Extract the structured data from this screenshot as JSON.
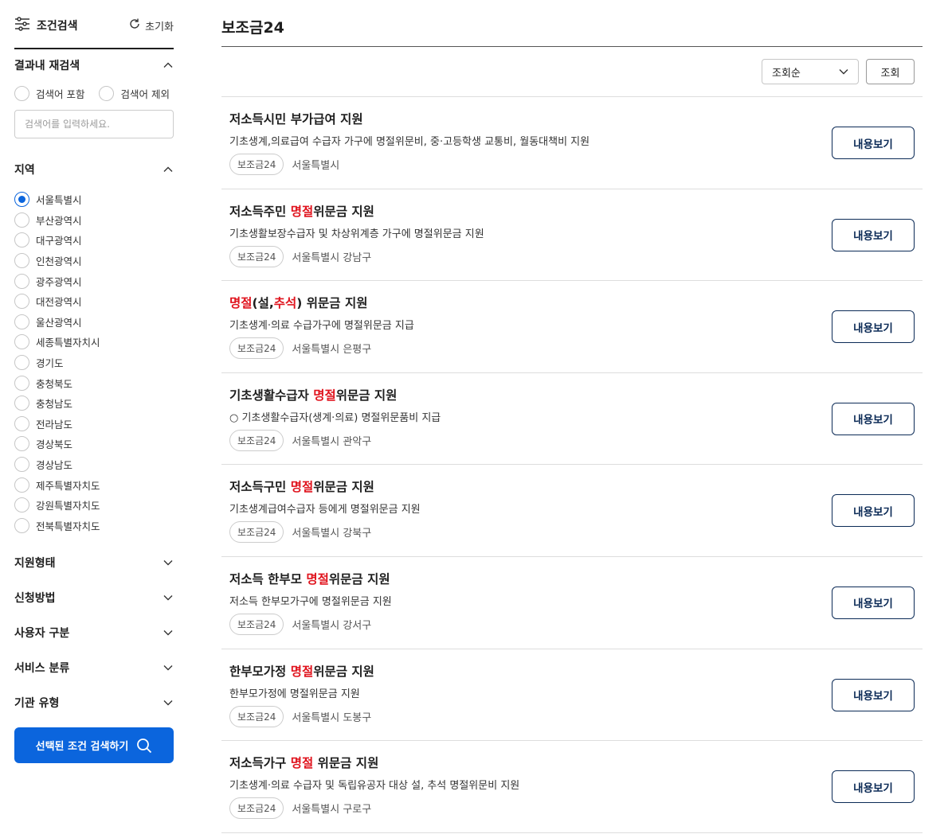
{
  "sidebar": {
    "title": "조건검색",
    "reset_label": "초기화",
    "refine": {
      "heading": "결과내 재검색",
      "include_label": "검색어 포함",
      "exclude_label": "검색어 제외",
      "input_placeholder": "검색어를 입력하세요."
    },
    "region": {
      "heading": "지역",
      "selected": "서울특별시",
      "options": [
        "서울특별시",
        "부산광역시",
        "대구광역시",
        "인천광역시",
        "광주광역시",
        "대전광역시",
        "울산광역시",
        "세종특별자치시",
        "경기도",
        "충청북도",
        "충청남도",
        "전라남도",
        "경상북도",
        "경상남도",
        "제주특별자치도",
        "강원특별자치도",
        "전북특별자치도"
      ]
    },
    "sections": [
      "지원형태",
      "신청방법",
      "사용자 구분",
      "서비스 분류",
      "기관 유형"
    ],
    "submit_label": "선택된 조건 검색하기"
  },
  "main": {
    "title": "보조금24",
    "sort_value": "조회순",
    "search_button": "조회",
    "detail_label": "내용보기",
    "items": [
      {
        "title_parts": [
          {
            "t": "저소득시민 부가급여 지원",
            "h": false
          }
        ],
        "desc": "기초생계,의료급여 수급자 가구에 명절위문비, 중·고등학생 교통비, 월동대책비 지원",
        "tag": "보조금24",
        "region": "서울특별시"
      },
      {
        "title_parts": [
          {
            "t": "저소득주민 ",
            "h": false
          },
          {
            "t": "명절",
            "h": true
          },
          {
            "t": "위문금 지원",
            "h": false
          }
        ],
        "desc": "기초생활보장수급자 및 차상위계층 가구에 명절위문금 지원",
        "tag": "보조금24",
        "region": "서울특별시 강남구"
      },
      {
        "title_parts": [
          {
            "t": "명절",
            "h": true
          },
          {
            "t": "(설,",
            "h": false
          },
          {
            "t": "추석",
            "h": true
          },
          {
            "t": ") 위문금 지원",
            "h": false
          }
        ],
        "desc": "기초생계·의료 수급가구에 명절위문금 지급",
        "tag": "보조금24",
        "region": "서울특별시 은평구"
      },
      {
        "title_parts": [
          {
            "t": "기초생활수급자 ",
            "h": false
          },
          {
            "t": "명절",
            "h": true
          },
          {
            "t": "위문금 지원",
            "h": false
          }
        ],
        "desc": "○ 기초생활수급자(생계·의료) 명절위문품비 지급",
        "tag": "보조금24",
        "region": "서울특별시 관악구"
      },
      {
        "title_parts": [
          {
            "t": "저소득구민 ",
            "h": false
          },
          {
            "t": "명절",
            "h": true
          },
          {
            "t": "위문금 지원",
            "h": false
          }
        ],
        "desc": "기초생계급여수급자 등에게 명절위문금 지원",
        "tag": "보조금24",
        "region": "서울특별시 강북구"
      },
      {
        "title_parts": [
          {
            "t": "저소득 한부모 ",
            "h": false
          },
          {
            "t": "명절",
            "h": true
          },
          {
            "t": "위문금 지원",
            "h": false
          }
        ],
        "desc": "저소득 한부모가구에 명절위문금 지원",
        "tag": "보조금24",
        "region": "서울특별시 강서구"
      },
      {
        "title_parts": [
          {
            "t": "한부모가정 ",
            "h": false
          },
          {
            "t": "명절",
            "h": true
          },
          {
            "t": "위문금 지원",
            "h": false
          }
        ],
        "desc": "한부모가정에 명절위문금 지원",
        "tag": "보조금24",
        "region": "서울특별시 도봉구"
      },
      {
        "title_parts": [
          {
            "t": "저소득가구 ",
            "h": false
          },
          {
            "t": "명절",
            "h": true
          },
          {
            "t": " 위문금 지원",
            "h": false
          }
        ],
        "desc": "기초생계·의료 수급자 및 독립유공자 대상 설, 추석 명절위문비 지원",
        "tag": "보조금24",
        "region": "서울특별시 구로구"
      }
    ]
  }
}
